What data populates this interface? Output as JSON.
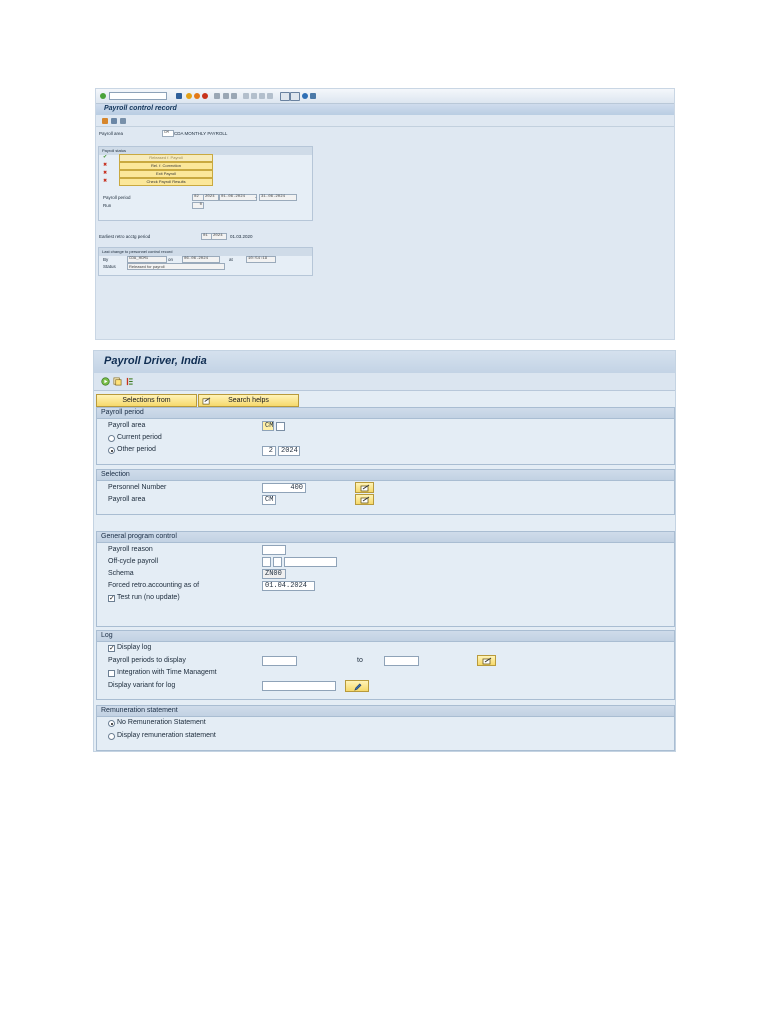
{
  "control_record": {
    "title": "Payroll control record",
    "payroll_area_label": "Payroll area",
    "payroll_area_value": "CM",
    "payroll_area_text": "CDA MONTHLY PAYROLL",
    "status_frame_label": "Payroll status",
    "status_buttons": [
      "Released f. Payroll",
      "Rel. f. Correction",
      "Exit Payroll",
      "Check Payroll Results"
    ],
    "status_marks": [
      "✔",
      "✖",
      "✖",
      "✖"
    ],
    "payroll_period_label": "Payroll period",
    "payroll_period_number": "02",
    "payroll_period_year": "2024",
    "period_from": "01.06.2024",
    "period_dash": "-",
    "period_to": "31.06.2024",
    "run_label": "Run",
    "run_value": "0",
    "earliest_retro_label": "Earliest retro acctg period",
    "earliest_retro_period": "01",
    "earliest_retro_year": "2024",
    "earliest_retro_date": "01.03.2020",
    "last_change_label": "Last change to personnel control record",
    "by_label": "By",
    "by_value": "CDA_HCM1",
    "on_label": "on",
    "on_value": "06.06.2024",
    "at_label": "at",
    "at_value": "10:54:19",
    "status_label": "Status",
    "status_value": "Released for payroll"
  },
  "payroll_driver": {
    "title": "Payroll Driver, India",
    "selections_from_button": "Selections from",
    "search_helps_button": "Search helps",
    "payroll_period_section": {
      "header": "Payroll period",
      "payroll_area_label": "Payroll area",
      "payroll_area_value": "CM",
      "current_period_label": "Current period",
      "other_period_label": "Other period",
      "other_period_number": "2",
      "other_period_year": "2024"
    },
    "selection_section": {
      "header": "Selection",
      "personnel_number_label": "Personnel Number",
      "personnel_number_value": "400",
      "payroll_area_label": "Payroll area",
      "payroll_area_value": "CM"
    },
    "general_section": {
      "header": "General program control",
      "payroll_reason_label": "Payroll reason",
      "off_cycle_label": "Off-cycle payroll",
      "schema_label": "Schema",
      "schema_value": "ZN00",
      "forced_retro_label": "Forced retro.accounting as of",
      "forced_retro_value": "01.04.2024",
      "test_run_label": "Test run (no update)"
    },
    "log_section": {
      "header": "Log",
      "display_log_label": "Display log",
      "periods_to_display_label": "Payroll periods to display",
      "to_label": "to",
      "integration_label": "Integration with Time Managemt",
      "display_variant_label": "Display variant for log"
    },
    "remuneration_section": {
      "header": "Remuneration statement",
      "no_statement_label": "No Remuneration Statement",
      "display_statement_label": "Display remuneration statement"
    }
  },
  "colors": {
    "sap_background": "#e4edf5",
    "section_header": "#c2d2e3",
    "button_yellow": "#f6d96b",
    "check_green": "#3a8f2a",
    "cross_red": "#c62b1a"
  }
}
